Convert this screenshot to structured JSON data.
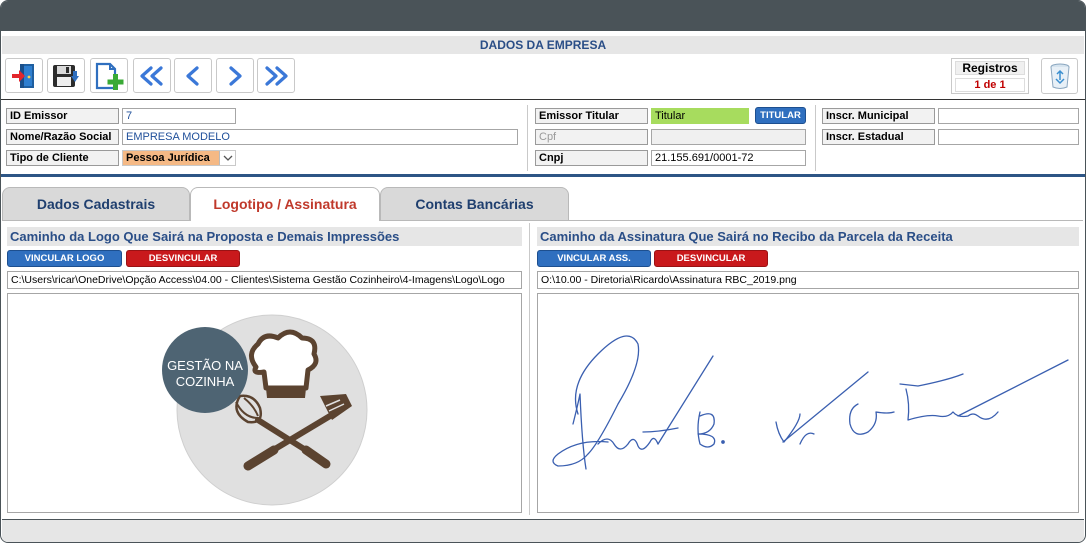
{
  "header": {
    "title": "DADOS DA EMPRESA"
  },
  "toolbar": {
    "buttons": [
      {
        "name": "exit-icon"
      },
      {
        "name": "save-icon"
      },
      {
        "name": "new-record-icon"
      },
      {
        "name": "first-record-icon"
      },
      {
        "name": "previous-record-icon"
      },
      {
        "name": "next-record-icon"
      },
      {
        "name": "last-record-icon"
      }
    ]
  },
  "registros": {
    "title": "Registros",
    "count": "1 de 1"
  },
  "trash": {
    "icon": "recycle-bin-icon"
  },
  "form": {
    "id_emissor": {
      "label": "ID Emissor",
      "value": "7"
    },
    "nome": {
      "label": "Nome/Razão Social",
      "value": "EMPRESA MODELO"
    },
    "tipo_cliente": {
      "label": "Tipo de Cliente",
      "value": "Pessoa Jurídica"
    },
    "emissor_titular": {
      "label": "Emissor Titular",
      "value": "Titular",
      "button": "TITULAR"
    },
    "cpf": {
      "label": "Cpf",
      "value": ""
    },
    "cnpj": {
      "label": "Cnpj",
      "value": "21.155.691/0001-72"
    },
    "inscr_municipal": {
      "label": "Inscr. Municipal",
      "value": ""
    },
    "inscr_estadual": {
      "label": "Inscr. Estadual",
      "value": ""
    }
  },
  "tabs": [
    {
      "label": "Dados Cadastrais",
      "active": false
    },
    {
      "label": "Logotipo / Assinatura",
      "active": true
    },
    {
      "label": "Contas Bancárias",
      "active": false
    }
  ],
  "logo_section": {
    "title": "Caminho da Logo Que Sairá na Proposta e Demais Impressões",
    "link_button": "VINCULAR LOGO",
    "unlink_button": "DESVINCULAR",
    "path": "C:\\Users\\ricar\\OneDrive\\Opção Access\\04.00 - Clientes\\Sistema Gestão Cozinheiro\\4-Imagens\\Logo\\Logo",
    "logo_text_line1": "GESTÃO NA",
    "logo_text_line2": "COZINHA"
  },
  "signature_section": {
    "title": "Caminho da Assinatura Que Sairá no Recibo da Parcela da Receita",
    "link_button": "VINCULAR ASS.",
    "unlink_button": "DESVINCULAR",
    "path": "O:\\10.00 - Diretoria\\Ricardo\\Assinatura RBC_2019.png"
  },
  "colors": {
    "accent_blue": "#2f6fbf",
    "accent_red": "#c9191c",
    "titular_green": "#a7dc5e",
    "tipo_orange": "#f5b985",
    "header_text": "#2a4e87"
  }
}
